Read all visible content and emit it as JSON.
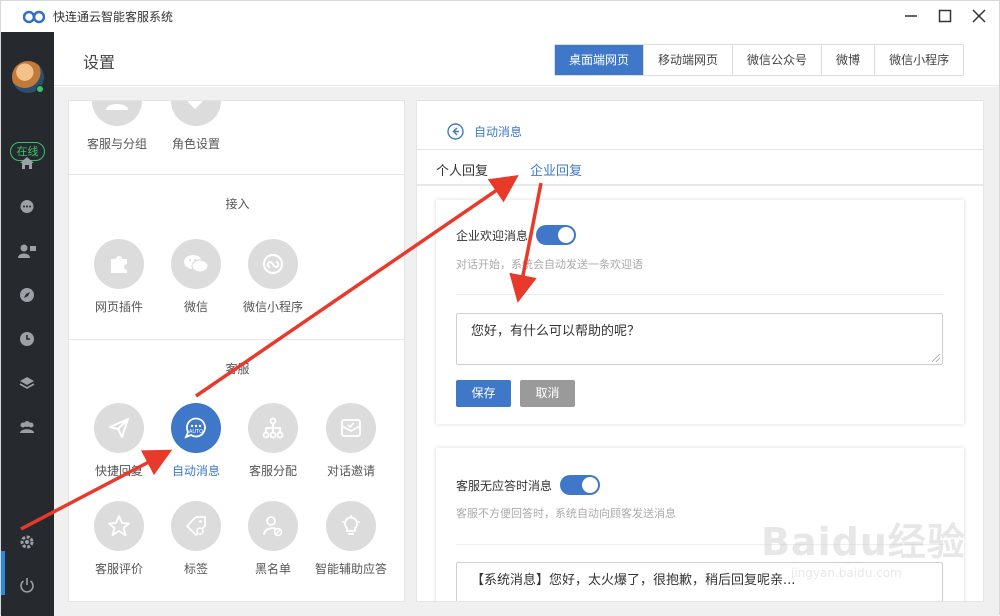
{
  "window": {
    "title": "快连通云智能客服系统",
    "controls": [
      "minimize-icon",
      "maximize-icon",
      "close-icon"
    ]
  },
  "sidebar": {
    "status": "在线",
    "status_color": "#3ac46a",
    "icons": [
      "home-icon",
      "chat-icon",
      "contacts-icon",
      "compass-icon",
      "clock-icon",
      "layers-icon",
      "team-icon",
      "settings-icon",
      "power-icon"
    ],
    "active_item": "settings-icon"
  },
  "header": {
    "title": "设置",
    "tabs": [
      {
        "label": "桌面端网页",
        "active": true
      },
      {
        "label": "移动端网页",
        "active": false
      },
      {
        "label": "微信公众号",
        "active": false
      },
      {
        "label": "微博",
        "active": false
      },
      {
        "label": "微信小程序",
        "active": false
      }
    ]
  },
  "left_panel": {
    "top_items": [
      {
        "label": "客服与分组",
        "icon": "group-icon"
      },
      {
        "label": "角色设置",
        "icon": "role-icon"
      }
    ],
    "sections": [
      {
        "title": "接入",
        "items": [
          {
            "label": "网页插件",
            "icon": "puzzle-icon"
          },
          {
            "label": "微信",
            "icon": "wechat-icon"
          },
          {
            "label": "微信小程序",
            "icon": "miniprogram-icon"
          }
        ]
      },
      {
        "title": "客服",
        "items": [
          {
            "label": "快捷回复",
            "icon": "send-icon"
          },
          {
            "label": "自动消息",
            "icon": "auto-message-icon",
            "active": true
          },
          {
            "label": "客服分配",
            "icon": "distribution-icon"
          },
          {
            "label": "对话邀请",
            "icon": "invite-icon"
          },
          {
            "label": "客服评价",
            "icon": "star-icon"
          },
          {
            "label": "标签",
            "icon": "tag-icon"
          },
          {
            "label": "黑名单",
            "icon": "blacklist-icon"
          },
          {
            "label": "智能辅助应答",
            "icon": "lightbulb-icon"
          }
        ]
      }
    ]
  },
  "right_panel": {
    "back_label": "自动消息",
    "sub_tabs": [
      {
        "label": "个人回复",
        "active": false
      },
      {
        "label": "企业回复",
        "active": true
      }
    ],
    "welcome": {
      "label": "企业欢迎消息",
      "enabled": true,
      "hint": "对话开始，系统会自动发送一条欢迎语",
      "message": "您好，有什么可以帮助的呢？",
      "save_label": "保存",
      "cancel_label": "取消"
    },
    "no_response": {
      "label": "客服无应答时消息",
      "enabled": true,
      "hint": "客服不方便回答时，系统自动向顾客发送消息",
      "message": "【系统消息】您好，太火爆了，很抱歉，稍后回复呢亲..."
    }
  },
  "watermark": {
    "main": "Baidu经验",
    "sub": "jingyan.baidu.com"
  },
  "colors": {
    "accent": "#3f78c8",
    "sidebar_bg": "#262a2e",
    "annotation_arrow": "#e83a2a"
  }
}
